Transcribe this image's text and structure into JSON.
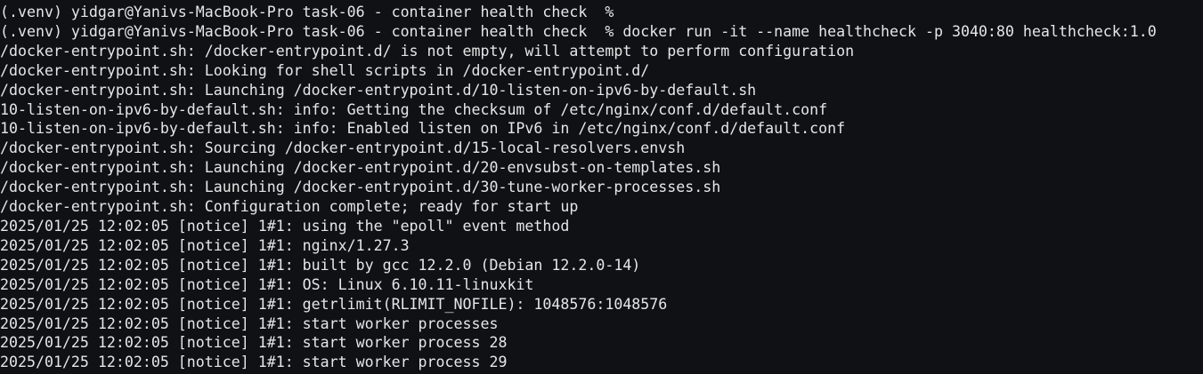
{
  "terminal": {
    "lines": [
      "(.venv) yidgar@Yanivs-MacBook-Pro task-06 - container health check  %",
      "(.venv) yidgar@Yanivs-MacBook-Pro task-06 - container health check  % docker run -it --name healthcheck -p 3040:80 healthcheck:1.0",
      "/docker-entrypoint.sh: /docker-entrypoint.d/ is not empty, will attempt to perform configuration",
      "/docker-entrypoint.sh: Looking for shell scripts in /docker-entrypoint.d/",
      "/docker-entrypoint.sh: Launching /docker-entrypoint.d/10-listen-on-ipv6-by-default.sh",
      "10-listen-on-ipv6-by-default.sh: info: Getting the checksum of /etc/nginx/conf.d/default.conf",
      "10-listen-on-ipv6-by-default.sh: info: Enabled listen on IPv6 in /etc/nginx/conf.d/default.conf",
      "/docker-entrypoint.sh: Sourcing /docker-entrypoint.d/15-local-resolvers.envsh",
      "/docker-entrypoint.sh: Launching /docker-entrypoint.d/20-envsubst-on-templates.sh",
      "/docker-entrypoint.sh: Launching /docker-entrypoint.d/30-tune-worker-processes.sh",
      "/docker-entrypoint.sh: Configuration complete; ready for start up",
      "2025/01/25 12:02:05 [notice] 1#1: using the \"epoll\" event method",
      "2025/01/25 12:02:05 [notice] 1#1: nginx/1.27.3",
      "2025/01/25 12:02:05 [notice] 1#1: built by gcc 12.2.0 (Debian 12.2.0-14)",
      "2025/01/25 12:02:05 [notice] 1#1: OS: Linux 6.10.11-linuxkit",
      "2025/01/25 12:02:05 [notice] 1#1: getrlimit(RLIMIT_NOFILE): 1048576:1048576",
      "2025/01/25 12:02:05 [notice] 1#1: start worker processes",
      "2025/01/25 12:02:05 [notice] 1#1: start worker process 28",
      "2025/01/25 12:02:05 [notice] 1#1: start worker process 29"
    ]
  },
  "colors": {
    "background": "#0f1114",
    "text": "#e6e6e6"
  }
}
